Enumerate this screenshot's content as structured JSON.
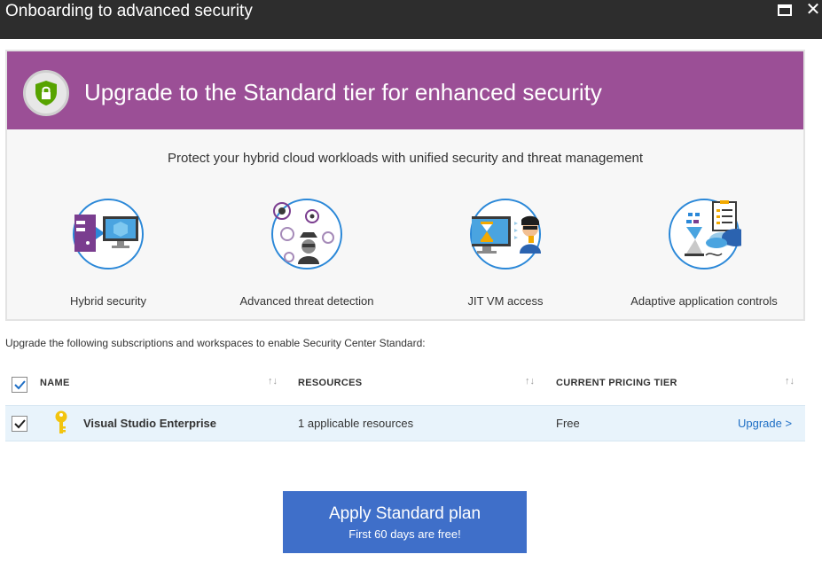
{
  "window": {
    "title": "Onboarding to advanced security",
    "maximize_icon": "maximize-icon",
    "close_icon": "close-icon"
  },
  "banner": {
    "heading": "Upgrade to the Standard tier for enhanced security",
    "icon": "shield-icon",
    "color": "#9b4f96"
  },
  "subheading": "Protect your hybrid cloud workloads with unified security and threat management",
  "features": [
    {
      "label": "Hybrid security",
      "icon": "hybrid-security-icon"
    },
    {
      "label": "Advanced threat detection",
      "icon": "threat-detection-icon"
    },
    {
      "label": "JIT VM access",
      "icon": "jit-vm-access-icon"
    },
    {
      "label": "Adaptive application controls",
      "icon": "adaptive-application-controls-icon"
    }
  ],
  "instructions": "Upgrade the following subscriptions and workspaces to enable Security Center Standard:",
  "table": {
    "columns": [
      "NAME",
      "RESOURCES",
      "CURRENT PRICING TIER"
    ],
    "select_all_checked": true,
    "rows": [
      {
        "checked": true,
        "icon": "key-icon",
        "name": "Visual Studio Enterprise",
        "resources": "1 applicable resources",
        "tier": "Free",
        "action": "Upgrade >"
      }
    ]
  },
  "apply_button": {
    "label": "Apply Standard plan",
    "sublabel": "First 60 days are free!",
    "color": "#3f6fc9"
  }
}
